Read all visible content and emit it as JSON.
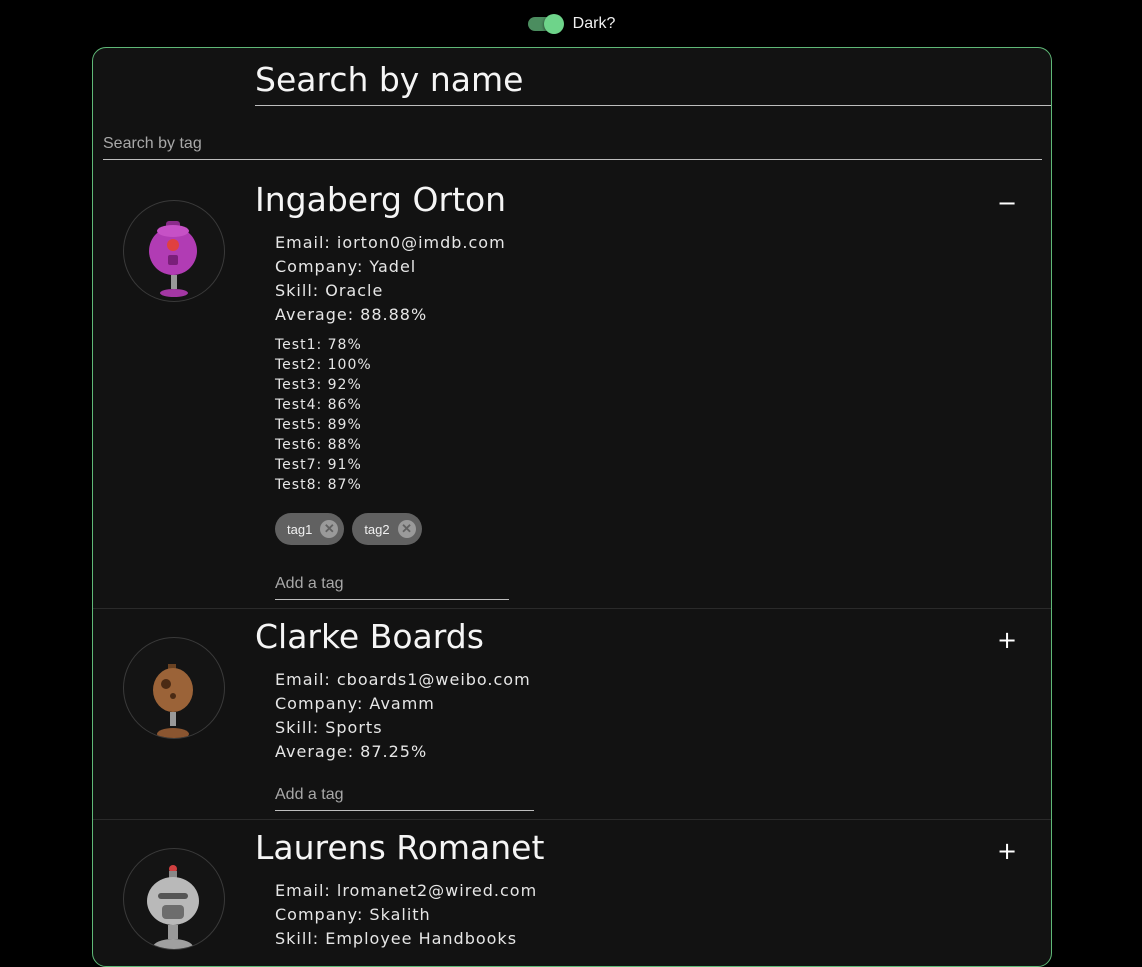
{
  "theme_toggle": {
    "label": "Dark?",
    "checked": true,
    "accent": "#6ed48a"
  },
  "search": {
    "name_placeholder": "Search by name",
    "tag_placeholder": "Search by tag"
  },
  "students": [
    {
      "name": "Ingaberg Orton",
      "expanded": true,
      "toggle_symbol": "−",
      "avatar_icon": "robot-purple-icon",
      "email": "Email: iorton0@imdb.com",
      "company": "Company: Yadel",
      "skill": "Skill: Oracle",
      "average": "Average: 88.88%",
      "tests": [
        "Test1: 78%",
        "Test2: 100%",
        "Test3: 92%",
        "Test4: 86%",
        "Test5: 89%",
        "Test6: 88%",
        "Test7: 91%",
        "Test8: 87%"
      ],
      "tags": [
        "tag1",
        "tag2"
      ],
      "add_tag_placeholder": "Add a tag"
    },
    {
      "name": "Clarke Boards",
      "expanded": false,
      "toggle_symbol": "+",
      "avatar_icon": "robot-brown-icon",
      "email": "Email: cboards1@weibo.com",
      "company": "Company: Avamm",
      "skill": "Skill: Sports",
      "average": "Average: 87.25%",
      "add_tag_placeholder": "Add a tag"
    },
    {
      "name": "Laurens Romanet",
      "expanded": false,
      "toggle_symbol": "+",
      "avatar_icon": "robot-gray-icon",
      "email": "Email: lromanet2@wired.com",
      "company": "Company: Skalith",
      "skill": "Skill: Employee Handbooks"
    }
  ]
}
